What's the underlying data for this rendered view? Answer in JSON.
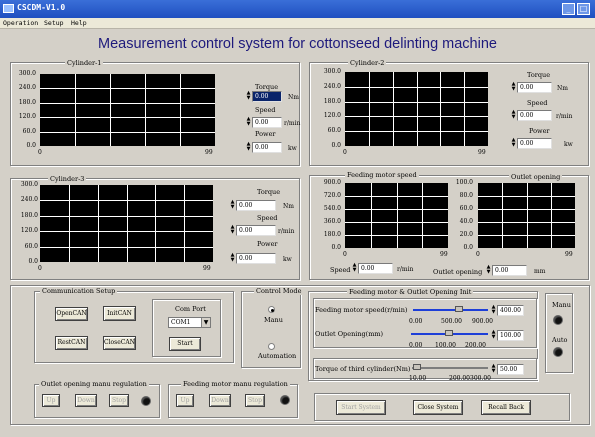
{
  "window": {
    "title": "CSCDM-V1.0",
    "min": "_",
    "max": "□"
  },
  "menu": [
    "Operation",
    "Setup",
    "Help"
  ],
  "main_title": "Measurement control system for cottonseed delinting machine",
  "y_ticks_a": [
    "300.0",
    "240.0",
    "180.0",
    "120.0",
    "60.0",
    "0.0"
  ],
  "y_ticks_b": [
    "900.0",
    "720.0",
    "540.0",
    "360.0",
    "180.0",
    "0.0"
  ],
  "y_ticks_c": [
    "100.0",
    "80.0",
    "60.0",
    "40.0",
    "20.0",
    "0.0"
  ],
  "x_start": "0",
  "x_end": "99",
  "cylinder1": {
    "title": "Cylinder-1",
    "torque_label": "Torque",
    "torque_value": "0.00",
    "torque_unit": "Nm",
    "speed_label": "Speed",
    "speed_value": "0.00",
    "speed_unit": "r/min",
    "power_label": "Power",
    "power_value": "0.00",
    "power_unit": "kw"
  },
  "cylinder2": {
    "title": "Cylinder-2",
    "torque_label": "Torque",
    "torque_value": "0.00",
    "torque_unit": "Nm",
    "speed_label": "Speed",
    "speed_value": "0.00",
    "speed_unit": "r/min",
    "power_label": "Power",
    "power_value": "0.00",
    "power_unit": "kw"
  },
  "cylinder3": {
    "title": "Cylinder-3",
    "torque_label": "Torque",
    "torque_value": "0.00",
    "torque_unit": "Nm",
    "speed_label": "Speed",
    "speed_value": "0.00",
    "speed_unit": "r/min",
    "power_label": "Power",
    "power_value": "0.00",
    "power_unit": "kw"
  },
  "feeding": {
    "title": "Feeding motor speed",
    "speed_label": "Speed",
    "speed_value": "0.00",
    "speed_unit": "r/min"
  },
  "outlet": {
    "title": "Outlet opening",
    "label": "Outlet opening",
    "value": "0.00",
    "unit": "mm"
  },
  "comm": {
    "title": "Communication Setup",
    "opencan": "OpenCAN",
    "initcan": "InitCAN",
    "resetcan": "RestCAN",
    "closecan": "CloseCAN",
    "port_title": "Com Port",
    "port_value": "COM1",
    "start": "Start"
  },
  "control_mode": {
    "title": "Control Mode",
    "manu": "Manu",
    "automation": "Automation"
  },
  "init": {
    "title": "Feeding motor & Outlet Opening Init",
    "feed_label": "Feeding motor speed(r/min)",
    "feed_value": "400.00",
    "feed_scale": [
      "0.00",
      "500.00",
      "900.00"
    ],
    "outlet_label": "Outlet Opening(mm)",
    "outlet_value": "100.00",
    "outlet_scale": [
      "0.00",
      "100.00",
      "200.00"
    ],
    "torque_label": "Torque of third cylinder(Nm)",
    "torque_value": "50.00",
    "torque_scale": [
      "10.00",
      "200.00",
      "300.00"
    ]
  },
  "mode_leds": {
    "manu": "Manu",
    "auto": "Auto"
  },
  "outlet_manu": {
    "title": "Outlet opening manu regulation",
    "up": "Up",
    "down": "Down",
    "stop": "Stop"
  },
  "feed_manu": {
    "title": "Feeding motor manu regulation",
    "up": "Up",
    "down": "Down",
    "stop": "Stop"
  },
  "actions": {
    "start": "Start System",
    "close": "Close System",
    "recall": "Recall Back"
  }
}
